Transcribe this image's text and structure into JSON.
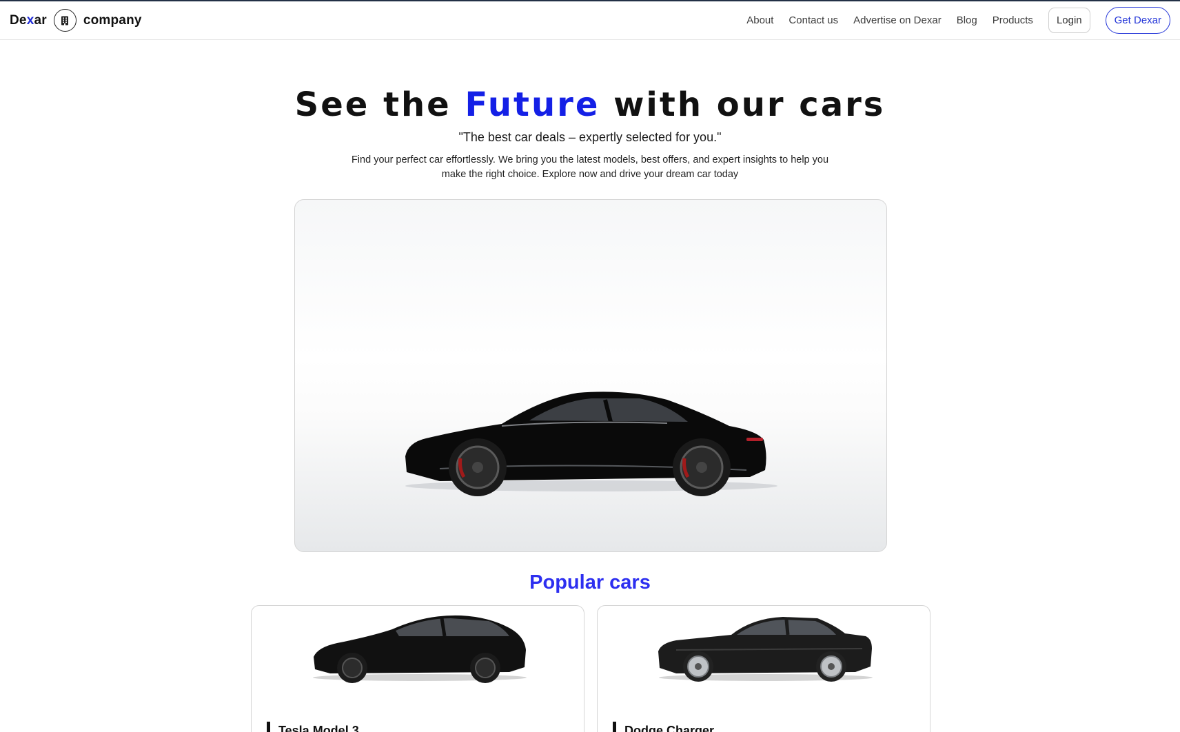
{
  "brand": {
    "name_start": "De",
    "name_accent": "x",
    "name_end": "ar",
    "logo_icon": "building-icon",
    "company": "company"
  },
  "nav": {
    "links": [
      "About",
      "Contact us",
      "Advertise on Dexar",
      "Blog",
      "Products"
    ],
    "login_label": "Login",
    "cta_label": "Get Dexar"
  },
  "hero": {
    "title_pre": "See the ",
    "title_highlight": "Future",
    "title_post": " with our cars",
    "quote": "\"The best car deals – expertly selected for you.\"",
    "description": "Find your perfect car effortlessly. We bring you the latest models, best offers, and expert insights to help you make the right choice. Explore now and drive your dream car today",
    "image_alt": "black-sports-car"
  },
  "popular": {
    "title": "Popular cars",
    "cars": [
      {
        "name": "Tesla Model 3"
      },
      {
        "name": "Dodge Charger"
      }
    ]
  },
  "colors": {
    "accent": "#1420e6",
    "section": "#2d2ff0",
    "cta": "#2234d8"
  }
}
